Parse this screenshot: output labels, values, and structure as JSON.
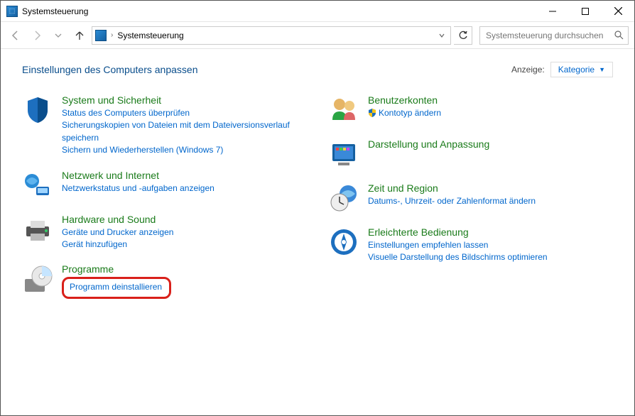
{
  "window": {
    "title": "Systemsteuerung"
  },
  "nav": {
    "breadcrumb": "Systemsteuerung",
    "search_placeholder": "Systemsteuerung durchsuchen"
  },
  "header": {
    "title": "Einstellungen des Computers anpassen",
    "view_label": "Anzeige:",
    "view_value": "Kategorie"
  },
  "left": [
    {
      "title": "System und Sicherheit",
      "links": [
        "Status des Computers überprüfen",
        "Sicherungskopien von Dateien mit dem Dateiversionsverlauf speichern",
        "Sichern und Wiederherstellen (Windows 7)"
      ]
    },
    {
      "title": "Netzwerk und Internet",
      "links": [
        "Netzwerkstatus und -aufgaben anzeigen"
      ]
    },
    {
      "title": "Hardware und Sound",
      "links": [
        "Geräte und Drucker anzeigen",
        "Gerät hinzufügen"
      ]
    },
    {
      "title": "Programme",
      "links": [
        "Programm deinstallieren"
      ]
    }
  ],
  "right": [
    {
      "title": "Benutzerkonten",
      "links": [
        "Kontotyp ändern"
      ]
    },
    {
      "title": "Darstellung und Anpassung",
      "links": []
    },
    {
      "title": "Zeit und Region",
      "links": [
        "Datums-, Uhrzeit- oder Zahlenformat ändern"
      ]
    },
    {
      "title": "Erleichterte Bedienung",
      "links": [
        "Einstellungen empfehlen lassen",
        "Visuelle Darstellung des Bildschirms optimieren"
      ]
    }
  ]
}
